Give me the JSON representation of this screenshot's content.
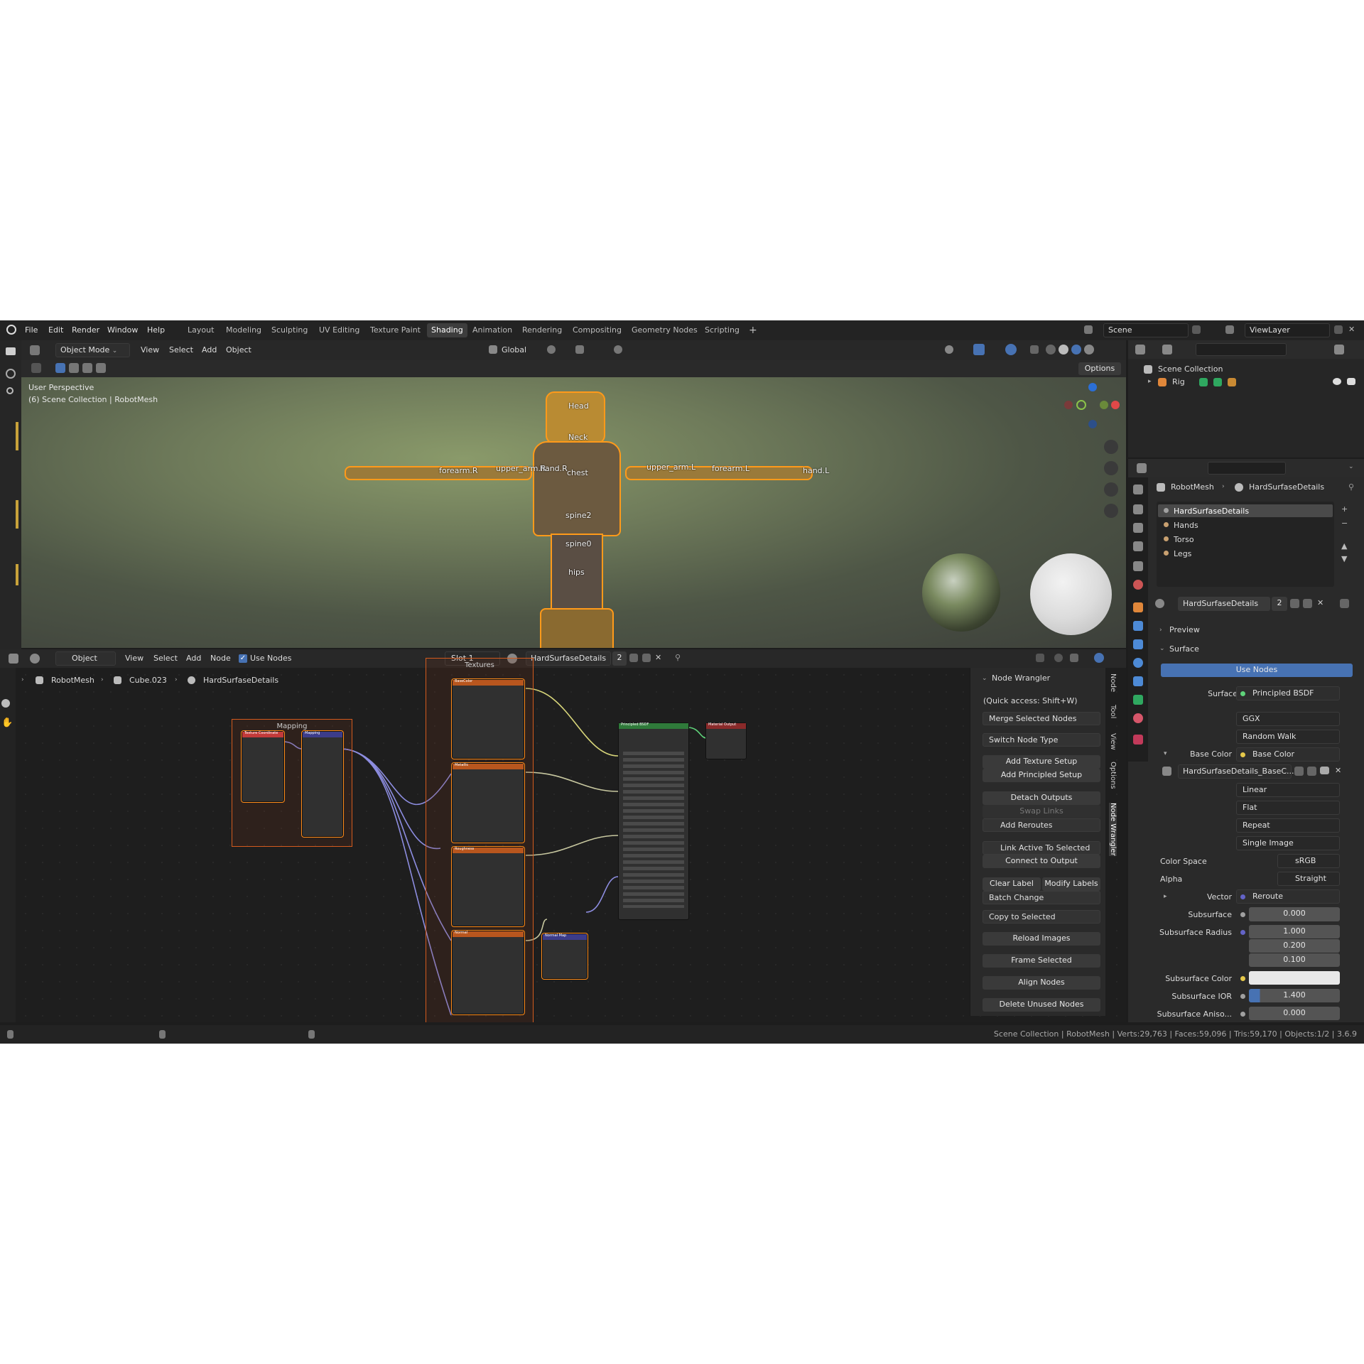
{
  "topbar": {
    "menus": [
      "File",
      "Edit",
      "Render",
      "Window",
      "Help"
    ],
    "workspaces": [
      "Layout",
      "Modeling",
      "Sculpting",
      "UV Editing",
      "Texture Paint",
      "Shading",
      "Animation",
      "Rendering",
      "Compositing",
      "Geometry Nodes",
      "Scripting"
    ],
    "active_workspace": "Shading",
    "add_tab": "+",
    "scene": "Scene",
    "view_layer": "ViewLayer"
  },
  "viewport": {
    "mode": "Object Mode",
    "menus": [
      "View",
      "Select",
      "Add",
      "Object"
    ],
    "orientation": "Global",
    "options": "Options",
    "overlay_line1": "User Perspective",
    "overlay_line2": "(6) Scene Collection | RobotMesh",
    "bones": [
      "Head",
      "Neck",
      "chest",
      "spine2",
      "spine0",
      "hips",
      "upper_arm.L",
      "upper_arm.R",
      "forearm.R",
      "hand.R",
      "forearm.L",
      "hand.L"
    ]
  },
  "outliner": {
    "root": "Scene Collection",
    "item": "Rig"
  },
  "node_editor": {
    "editor_type": "Object",
    "menus": [
      "View",
      "Select",
      "Add",
      "Node"
    ],
    "use_nodes": "Use Nodes",
    "slot": "Slot 1",
    "material": "HardSurfaseDetails",
    "users": "2",
    "breadcrumb": [
      "RobotMesh",
      "Cube.023",
      "HardSurfaseDetails"
    ],
    "frames": {
      "mapping": "Mapping",
      "textures": "Textures"
    },
    "nodes": {
      "texcoord": "Texture Coordinate",
      "mapping": "Mapping",
      "basecolor": "BaseColor",
      "metallic": "Metallic",
      "roughness": "Roughness",
      "normal": "Normal",
      "normal_map": "Normal Map",
      "bsdf": "Principled BSDF",
      "output": "Material Output"
    },
    "tabs": [
      "Node",
      "Tool",
      "View",
      "Options",
      "Node Wrangler"
    ]
  },
  "node_wrangler": {
    "title": "Node Wrangler",
    "hint": "(Quick access: Shift+W)",
    "merge": "Merge Selected Nodes",
    "switch": "Switch Node Type",
    "add_texture": "Add Texture Setup",
    "add_principled": "Add Principled Setup",
    "detach": "Detach Outputs",
    "swap": "Swap Links",
    "add_reroutes": "Add Reroutes",
    "link_active": "Link Active To Selected",
    "connect_output": "Connect to Output",
    "clear_label": "Clear Label",
    "modify_labels": "Modify Labels",
    "batch": "Batch Change",
    "copy_selected": "Copy to Selected",
    "reload": "Reload Images",
    "frame": "Frame Selected",
    "align": "Align Nodes",
    "delete_unused": "Delete Unused Nodes"
  },
  "properties": {
    "breadcrumb_object": "RobotMesh",
    "breadcrumb_material": "HardSurfaseDetails",
    "materials": [
      "HardSurfaseDetails",
      "Hands",
      "Torso",
      "Legs"
    ],
    "material_field": "HardSurfaseDetails",
    "users": "2",
    "preview": "Preview",
    "surface_panel": "Surface",
    "use_nodes": "Use Nodes",
    "surface_label": "Surface",
    "surface_value": "Principled BSDF",
    "distribution": "GGX",
    "subsurface_method": "Random Walk",
    "base_color_label": "Base Color",
    "base_color_value": "Base Color",
    "image": "HardSurfaseDetails_BaseC...",
    "interp": "Linear",
    "projection": "Flat",
    "extension": "Repeat",
    "source": "Single Image",
    "color_space_label": "Color Space",
    "color_space": "sRGB",
    "alpha_label": "Alpha",
    "alpha": "Straight",
    "vector_label": "Vector",
    "vector_value": "Reroute",
    "subsurface_label": "Subsurface",
    "subsurface": "0.000",
    "radius_label": "Subsurface Radius",
    "radius": [
      "1.000",
      "0.200",
      "0.100"
    ],
    "ss_color_label": "Subsurface Color",
    "ss_ior_label": "Subsurface IOR",
    "ss_ior": "1.400",
    "ss_aniso_label": "Subsurface Aniso...",
    "ss_aniso": "0.000"
  },
  "statusbar": {
    "text": "Scene Collection | RobotMesh | Verts:29,763 | Faces:59,096 | Tris:59,170 | Objects:1/2 | 3.6.9"
  },
  "colors": {
    "accent": "#4772b3",
    "selection": "#ff8c1a",
    "frame": "#d45b1e",
    "bg": "#1d1d1d"
  }
}
